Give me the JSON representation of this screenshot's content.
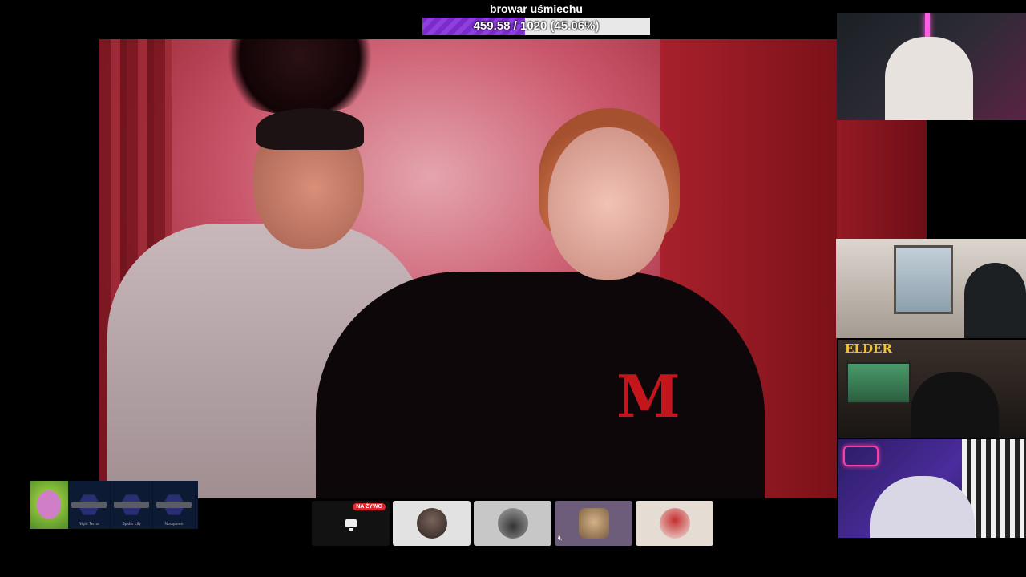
{
  "goal": {
    "title": "browar uśmiechu",
    "progress_text": "459.58 / 1020 (45.06%)",
    "progress_fraction": 0.4506,
    "fill_color": "#8f3fe0"
  },
  "main_video": {
    "shirt_logo": "M"
  },
  "side_cams": {
    "cam3_brand": "ELDER"
  },
  "skins": [
    {
      "name": "Night Terror"
    },
    {
      "name": "Spider Lily"
    },
    {
      "name": "Neoqueen"
    }
  ],
  "bottombar": {
    "live_badge": "NA ŻYWO"
  }
}
